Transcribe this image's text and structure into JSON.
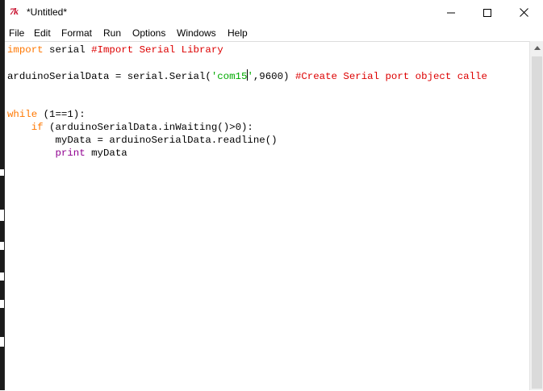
{
  "window": {
    "app_icon_text": "7k",
    "title": "*Untitled*",
    "controls": {
      "minimize_icon": "minimize-icon",
      "maximize_icon": "maximize-icon",
      "close_icon": "close-icon"
    }
  },
  "menubar": {
    "items": [
      {
        "label": "File"
      },
      {
        "label": "Edit"
      },
      {
        "label": "Format"
      },
      {
        "label": "Run"
      },
      {
        "label": "Options"
      },
      {
        "label": "Windows"
      },
      {
        "label": "Help"
      }
    ]
  },
  "editor": {
    "line1": {
      "kw": "import",
      "text": " serial ",
      "comment": "#Import Serial Library"
    },
    "line3": {
      "pre": "arduinoSerialData = serial.Serial(",
      "str_a": "'com15",
      "str_b": "'",
      "post": ",9600) ",
      "comment": "#Create Serial port object calle"
    },
    "line5": {
      "kw": "while",
      "text": " (1==1):"
    },
    "line6": {
      "indent": "    ",
      "kw": "if",
      "text": " (arduinoSerialData.inWaiting()>0):"
    },
    "line7": {
      "text": "        myData = arduinoSerialData.readline()"
    },
    "line8": {
      "indent": "        ",
      "builtin": "print",
      "text": " myData"
    }
  },
  "colors": {
    "keyword": "#ff7700",
    "comment": "#dd0000",
    "string": "#00aa00",
    "builtin": "#900090",
    "icon_accent": "#c8102e"
  }
}
